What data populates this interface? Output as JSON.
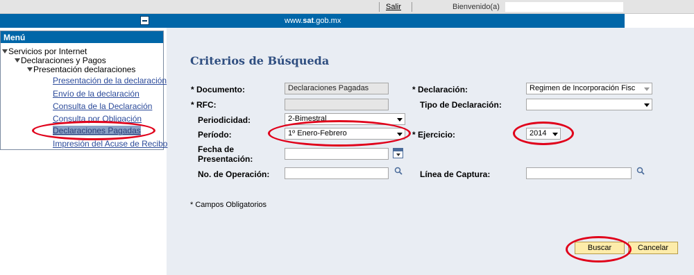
{
  "header": {
    "logout_label": "Salir",
    "welcome_label": "Bienvenido(a)",
    "site_url_prefix": "www.",
    "site_url_brand": "sat",
    "site_url_suffix": ".gob.mx"
  },
  "menu": {
    "title": "Menú",
    "items": [
      {
        "label": "Servicios por Internet",
        "level": 0,
        "expanded": true
      },
      {
        "label": "Declaraciones y Pagos",
        "level": 1,
        "expanded": true
      },
      {
        "label": "Presentación declaraciones",
        "level": 2,
        "expanded": true
      },
      {
        "label": "Presentación de la declaración",
        "level": 3,
        "link": true
      },
      {
        "label": "Envío de la declaración",
        "level": 3,
        "link": true
      },
      {
        "label": "Consulta de la Declaración",
        "level": 3,
        "link": true
      },
      {
        "label": "Consulta por Obligación",
        "level": 3,
        "link": true
      },
      {
        "label": "Declaraciones Pagadas",
        "level": 3,
        "link": true,
        "selected": true
      },
      {
        "label": "Impresión del Acuse de Recibo",
        "level": 3,
        "link": true
      }
    ]
  },
  "form": {
    "title": "Criterios de Búsqueda",
    "documento_label": "* Documento:",
    "documento_value": "Declaraciones Pagadas",
    "declaracion_label": "* Declaración:",
    "declaracion_value": "Regimen de Incorporación Fisc",
    "rfc_label": "* RFC:",
    "rfc_value": "",
    "tipo_label": "Tipo de Declaración:",
    "tipo_value": "",
    "periodicidad_label": "Periodicidad:",
    "periodicidad_value": "2-Bimestral",
    "periodo_label": "Período:",
    "periodo_value": "1º Enero-Febrero",
    "ejercicio_label": "* Ejercicio:",
    "ejercicio_value": "2014",
    "fecha_label_line1": "Fecha de",
    "fecha_label_line2": "Presentación:",
    "fecha_value": "",
    "operacion_label": "No. de Operación:",
    "operacion_value": "",
    "captura_label": "Línea de Captura:",
    "captura_value": "",
    "required_note": "* Campos Obligatorios",
    "search_button": "Buscar",
    "cancel_button": "Cancelar"
  },
  "colors": {
    "brand_blue": "#0066a8",
    "title_blue": "#2f4e80",
    "annotation_red": "#e0001a",
    "button_fill": "#fdecaa"
  }
}
